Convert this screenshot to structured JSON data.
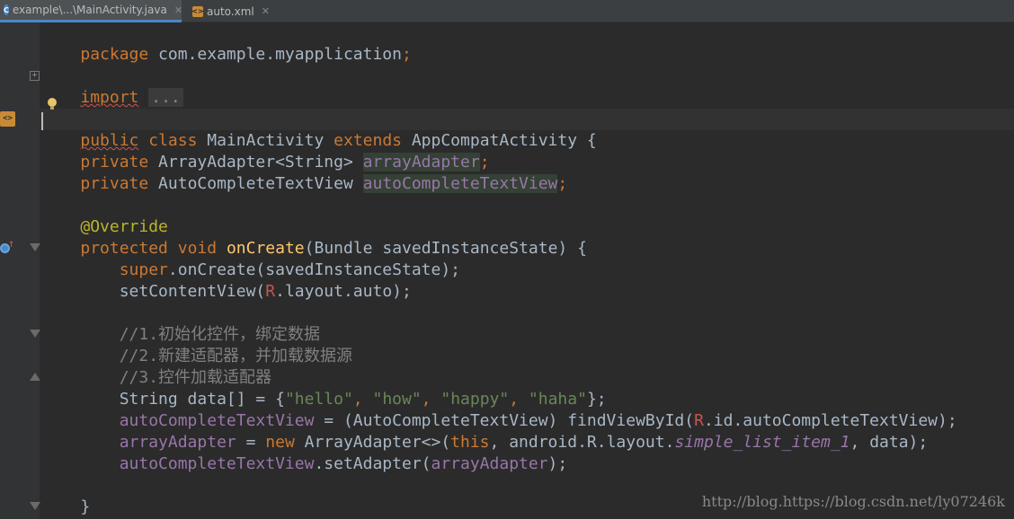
{
  "tabs": [
    {
      "label": "example\\...\\MainActivity.java",
      "icon": "java-class-icon",
      "close": "✕"
    },
    {
      "label": "auto.xml",
      "icon": "xml-file-icon",
      "close": "✕"
    }
  ],
  "code": {
    "l1": {
      "kw": "package",
      "rest": " com.example.myapplication",
      "semi": ";"
    },
    "l3": {
      "kw": "import",
      "fold": "..."
    },
    "l5": {
      "kw1": "public",
      "kw2": "class",
      "name": " MainActivity ",
      "kw3": "extends",
      "rest": " AppCompatActivity {"
    },
    "l7": {
      "kw": "private",
      "type": " ArrayAdapter<String> ",
      "field": "arrayAdapter",
      "semi": ";"
    },
    "l8": {
      "kw": "private",
      "type": " AutoCompleteTextView ",
      "field": "autoCompleteTextView",
      "semi": ";"
    },
    "l10": {
      "ann": "@Override"
    },
    "l11": {
      "kw1": "protected",
      "kw2": "void",
      "fn": "onCreate",
      "rest": "(Bundle savedInstanceState) {"
    },
    "l12": {
      "kw": "super",
      "rest": ".onCreate(savedInstanceState);"
    },
    "l13": {
      "a": "setContentView(",
      "r": "R",
      "b": ".layout.auto);"
    },
    "l15": "//1.初始化控件，绑定数据",
    "l16": "//2.新建适配器，并加载数据源",
    "l17": "//3.控件加载适配器",
    "l18": {
      "a": "String data[] = {",
      "s1": "\"hello\"",
      "c1": ", ",
      "s2": "\"how\"",
      "c2": ", ",
      "s3": "\"happy\"",
      "c3": ", ",
      "s4": "\"haha\"",
      "end": "};"
    },
    "l19": {
      "f": "autoCompleteTextView",
      "a": " = (AutoCompleteTextView) findViewById(",
      "r": "R",
      "b": ".id.autoCompleteTextView);"
    },
    "l20": {
      "f": "arrayAdapter",
      "a": " = ",
      "kw": "new",
      "b": " ArrayAdapter<>(",
      "kw2": "this",
      "c": ", android.R.layout.",
      "it": "simple_list_item_1",
      "d": ", data);"
    },
    "l21": {
      "f1": "autoCompleteTextView",
      "a": ".setAdapter(",
      "f2": "arrayAdapter",
      "b": ");"
    },
    "l23": "}"
  },
  "watermark": "http://blog.https://blog.csdn.net/ly07246k"
}
